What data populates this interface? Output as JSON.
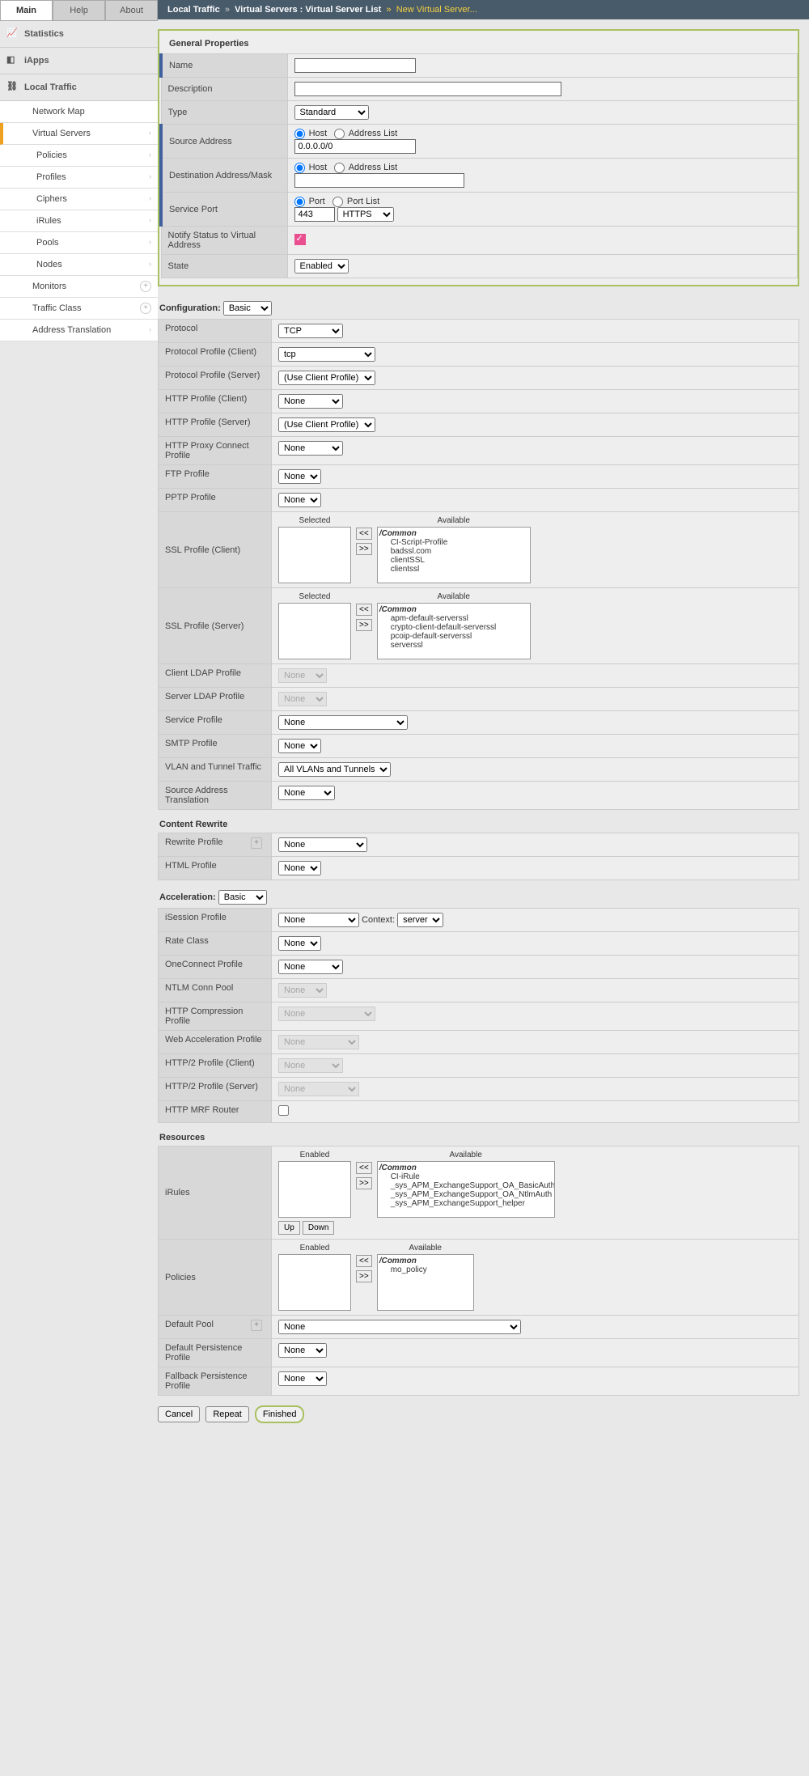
{
  "tabs": {
    "main": "Main",
    "help": "Help",
    "about": "About"
  },
  "nav": {
    "statistics": "Statistics",
    "iapps": "iApps",
    "local_traffic": "Local Traffic",
    "items": [
      "Network Map",
      "Virtual Servers",
      "Policies",
      "Profiles",
      "Ciphers",
      "iRules",
      "Pools",
      "Nodes",
      "Monitors",
      "Traffic Class",
      "Address Translation"
    ]
  },
  "breadcrumb": {
    "a": "Local Traffic",
    "b": "Virtual Servers : Virtual Server List",
    "c": "New Virtual Server..."
  },
  "general": {
    "title": "General Properties",
    "labels": {
      "name": "Name",
      "desc": "Description",
      "type": "Type",
      "src": "Source Address",
      "dst": "Destination Address/Mask",
      "port": "Service Port",
      "notify": "Notify Status to Virtual Address",
      "state": "State"
    },
    "type_val": "Standard",
    "radio": {
      "host": "Host",
      "addrlist": "Address List",
      "port": "Port",
      "portlist": "Port List"
    },
    "src_val": "0.0.0.0/0",
    "port_val": "443",
    "port_svc": "HTTPS",
    "state_val": "Enabled"
  },
  "config": {
    "label": "Configuration:",
    "level": "Basic",
    "rows": {
      "protocol": "Protocol",
      "protocol_val": "TCP",
      "ppc": "Protocol Profile (Client)",
      "ppc_val": "tcp",
      "pps": "Protocol Profile (Server)",
      "pps_val": "(Use Client Profile)",
      "hpc": "HTTP Profile (Client)",
      "hpc_val": "None",
      "hps": "HTTP Profile (Server)",
      "hps_val": "(Use Client Profile)",
      "hpx": "HTTP Proxy Connect Profile",
      "hpx_val": "None",
      "ftp": "FTP Profile",
      "ftp_val": "None",
      "pptp": "PPTP Profile",
      "pptp_val": "None",
      "sslc": "SSL Profile (Client)",
      "ssls": "SSL Profile (Server)",
      "cldap": "Client LDAP Profile",
      "cldap_val": "None",
      "sldap": "Server LDAP Profile",
      "sldap_val": "None",
      "svc": "Service Profile",
      "svc_val": "None",
      "smtp": "SMTP Profile",
      "smtp_val": "None",
      "vlan": "VLAN and Tunnel Traffic",
      "vlan_val": "All VLANs and Tunnels",
      "sat": "Source Address Translation",
      "sat_val": "None"
    },
    "dual": {
      "selected": "Selected",
      "available": "Available",
      "common": "/Common",
      "sslc_items": [
        "CI-Script-Profile",
        "badssl.com",
        "clientSSL",
        "clientssl"
      ],
      "ssls_items": [
        "apm-default-serverssl",
        "crypto-client-default-serverssl",
        "pcoip-default-serverssl",
        "serverssl"
      ]
    }
  },
  "rewrite": {
    "title": "Content Rewrite",
    "rp": "Rewrite Profile",
    "rp_val": "None",
    "hp": "HTML Profile",
    "hp_val": "None"
  },
  "accel": {
    "label": "Acceleration:",
    "level": "Basic",
    "rows": {
      "isess": "iSession Profile",
      "isess_val": "None",
      "ctx_label": "Context:",
      "ctx_val": "server",
      "rate": "Rate Class",
      "rate_val": "None",
      "onec": "OneConnect Profile",
      "onec_val": "None",
      "ntlm": "NTLM Conn Pool",
      "ntlm_val": "None",
      "hcomp": "HTTP Compression Profile",
      "hcomp_val": "None",
      "wacc": "Web Acceleration Profile",
      "wacc_val": "None",
      "h2c": "HTTP/2 Profile (Client)",
      "h2c_val": "None",
      "h2s": "HTTP/2 Profile (Server)",
      "h2s_val": "None",
      "mrf": "HTTP MRF Router"
    }
  },
  "resources": {
    "title": "Resources",
    "enabled": "Enabled",
    "available": "Available",
    "common": "/Common",
    "irules": "iRules",
    "irules_items": [
      "CI-iRule",
      "_sys_APM_ExchangeSupport_OA_BasicAuth",
      "_sys_APM_ExchangeSupport_OA_NtlmAuth",
      "_sys_APM_ExchangeSupport_helper"
    ],
    "up": "Up",
    "down": "Down",
    "policies": "Policies",
    "policies_items": [
      "mo_policy"
    ],
    "dpool": "Default Pool",
    "dpool_val": "None",
    "dpp": "Default Persistence Profile",
    "dpp_val": "None",
    "fpp": "Fallback Persistence Profile",
    "fpp_val": "None"
  },
  "footer": {
    "cancel": "Cancel",
    "repeat": "Repeat",
    "finished": "Finished"
  }
}
